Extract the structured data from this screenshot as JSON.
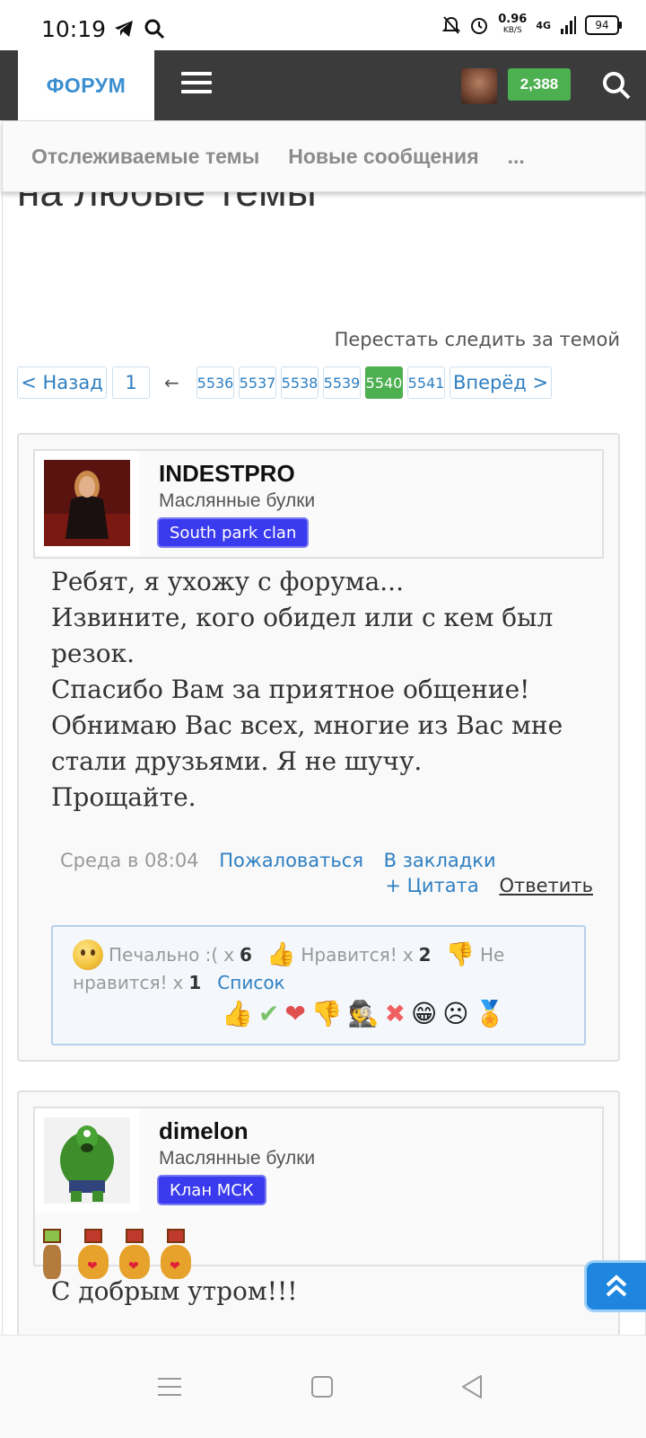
{
  "status_bar": {
    "time": "10:19",
    "net_speed": "0.96",
    "net_unit": "KB/S",
    "network": "4G",
    "battery": "94",
    "icons": [
      "telegram-icon",
      "search-icon",
      "mute-bell-icon",
      "alarm-icon",
      "signal-icon"
    ]
  },
  "topnav": {
    "forum_tab": "ФОРУМ",
    "score": "2,388"
  },
  "subnav": {
    "items": [
      "Отслеживаемые темы",
      "Новые сообщения",
      "..."
    ]
  },
  "thread": {
    "title_partial": "на любые темы",
    "unfollow": "Перестать следить за темой"
  },
  "pager": {
    "prev": "< Назад",
    "first": "1",
    "ellipsis_arrow": "←",
    "pages": [
      "5536",
      "5537",
      "5538",
      "5539",
      "5540",
      "5541"
    ],
    "current": "5540",
    "next": "Вперёд >"
  },
  "posts": [
    {
      "username": "INDESTPRO",
      "rank": "Маслянные булки",
      "clan": "South park clan",
      "body": [
        "Ребят, я ухожу с форума...",
        "Извините, кого обидел или с кем был",
        "резок.",
        "Спасибо Вам за приятное общение!",
        "Обнимаю Вас всех, многие из Вас мне",
        "стали друзьями. Я не шучу.",
        "Прощайте."
      ],
      "time": "Среда в 08:04",
      "report": "Пожаловаться",
      "bookmark": "В закладки",
      "quote": "+ Цитата",
      "reply": "Ответить",
      "reactions": {
        "sad_label": "Печально :(",
        "sad_x": "x",
        "sad_count": "6",
        "like_label": "Нравится!",
        "like_x": "x",
        "like_count": "2",
        "dislike_label_1": "Не",
        "dislike_label_2": "нравится!",
        "dislike_x": "x",
        "dislike_count": "1",
        "list": "Список"
      }
    },
    {
      "username": "dimelon",
      "rank": "Маслянные булки",
      "clan": "Клан МСК",
      "body": [
        "С добрым утром!!!"
      ]
    }
  ],
  "colors": {
    "accent_blue": "#3b8fd0",
    "score_green": "#4caf50",
    "clan_blue": "#3a3aee",
    "nav_dark": "#3b3b3b"
  }
}
